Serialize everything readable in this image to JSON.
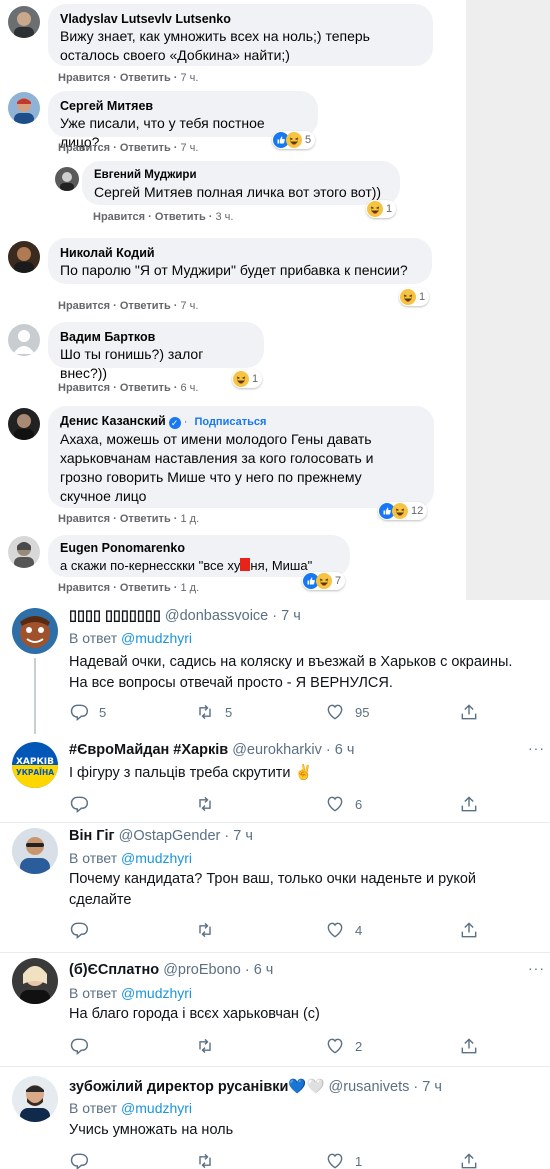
{
  "facebook": {
    "comments": [
      {
        "name": "Vladyslav Lutsevlv Lutsenko",
        "lines": [
          "Вижу знает, как умножить всех на ноль;) теперь",
          "осталось своего «Добкина» найти;)"
        ],
        "like": "Нравится",
        "reply": "Ответить",
        "time": "7 ч."
      },
      {
        "name": "Сергей Митяев",
        "lines": [
          "Уже писали, что у тебя постное лицо?"
        ],
        "like": "Нравится",
        "reply": "Ответить",
        "time": "7 ч.",
        "reactions": [
          "like",
          "haha"
        ],
        "reaction_count": "5"
      },
      {
        "name": "Евгений Муджири",
        "mention": "Сергей Митяев",
        "text": " полная личка вот этого вот))",
        "like": "Нравится",
        "reply": "Ответить",
        "time": "3 ч.",
        "reactions": [
          "haha"
        ],
        "reaction_count": "1"
      },
      {
        "name": "Николай Кодий",
        "lines": [
          "По паролю \"Я от Муджири\" будет прибавка к пенсии?"
        ],
        "like": "Нравится",
        "reply": "Ответить",
        "time": "7 ч.",
        "reactions": [
          "haha"
        ],
        "reaction_count": "1"
      },
      {
        "name": "Вадим Бартков",
        "lines": [
          "Шо ты гонишь?) залог внес?))"
        ],
        "like": "Нравится",
        "reply": "Ответить",
        "time": "6 ч.",
        "reactions": [
          "haha"
        ],
        "reaction_count": "1"
      },
      {
        "name": "Денис Казанский",
        "subscribe": "Подписаться",
        "lines": [
          "Ахаха, можешь от имени молодого Гены давать",
          "харьковчанам наставления за кого голосовать и",
          "грозно говорить Мише что у него по прежнему",
          "скучное лицо"
        ],
        "like": "Нравится",
        "reply": "Ответить",
        "time": "1 д.",
        "reactions": [
          "like",
          "haha"
        ],
        "reaction_count": "12"
      },
      {
        "name": "Eugen Ponomarenko",
        "text_before": "а скажи по-кернесскки \"все ху",
        "text_after": "ня, Миша\"",
        "like": "Нравится",
        "reply": "Ответить",
        "time": "1 д.",
        "reactions": [
          "like",
          "haha"
        ],
        "reaction_count": "7"
      }
    ]
  },
  "twitter": {
    "reply_prefix": "В ответ",
    "tweets": [
      {
        "name": "▯▯▯▯ ▯▯▯▯▯▯▯",
        "handle": "@donbassvoice",
        "time": "7 ч",
        "reply_to": "@mudzhyri",
        "lines": [
          "Надевай очки, садись на коляску и въезжай в Харьков с окраины.",
          "На все вопросы отвечай просто -  Я ВЕРНУЛСЯ."
        ],
        "replies": "5",
        "retweets": "5",
        "likes": "95"
      },
      {
        "name": "#ЄвроМайдан #Харків",
        "handle": "@eurokharkiv",
        "time": "6 ч",
        "lines": [
          "І фігуру з пальців треба скрутити ✌"
        ],
        "replies": "",
        "retweets": "",
        "likes": "6",
        "avatar_text_1": "ХАРКІВ",
        "avatar_text_2": "УКРАЇНА"
      },
      {
        "name": "Він Гіг",
        "handle": "@OstapGender",
        "time": "7 ч",
        "reply_to": "@mudzhyri",
        "lines": [
          "Почему кандидата? Трон ваш, только очки наденьте и рукой",
          "сделайте"
        ],
        "replies": "",
        "retweets": "",
        "likes": "4"
      },
      {
        "name": "(б)ЄСплатно",
        "handle": "@proEbono",
        "time": "6 ч",
        "reply_to": "@mudzhyri",
        "lines": [
          "На благо города і всєх харьковчан (с)"
        ],
        "replies": "",
        "retweets": "",
        "likes": "2"
      },
      {
        "name": "зубожілий директор русанівки💙🤍",
        "handle": "@rusanivets",
        "time": "7 ч",
        "reply_to": "@mudzhyri",
        "lines": [
          "Учись умножать на ноль"
        ],
        "replies": "",
        "retweets": "",
        "likes": "1"
      }
    ]
  },
  "colors": {
    "fb_bubble": "#f0f2f5",
    "fb_meta": "#65676b",
    "tw_link": "#1b95e0",
    "tw_meta": "#5b7083"
  }
}
